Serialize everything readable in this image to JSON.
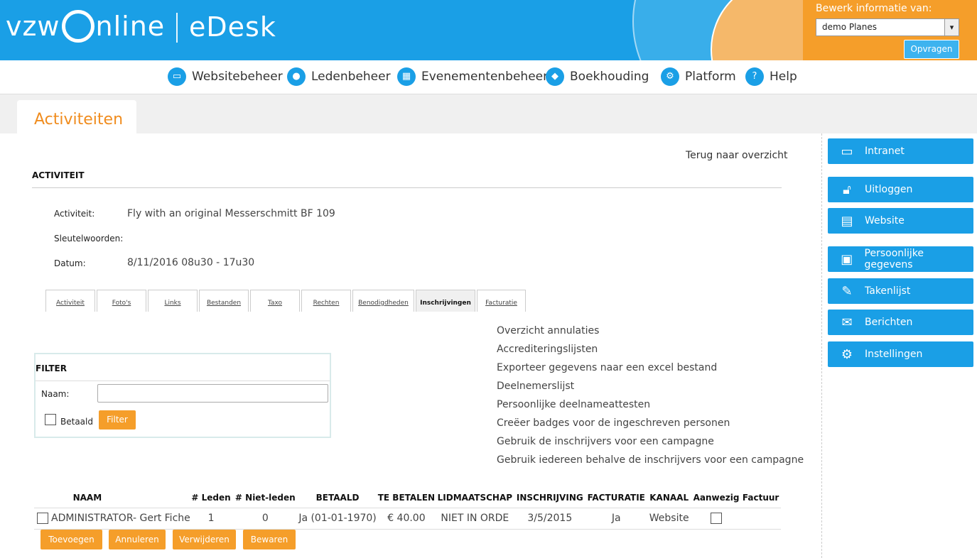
{
  "header": {
    "logo_left": "vzw",
    "logo_right": "nline",
    "product": "eDesk",
    "bewerk_label": "Bewerk informatie van:",
    "bewerk_value": "demo Planes",
    "opvragen": "Opvragen"
  },
  "nav": [
    {
      "label": "Websitebeheer",
      "icon": "monitor-icon"
    },
    {
      "label": "Ledenbeheer",
      "icon": "user-icon"
    },
    {
      "label": "Evenementenbeheer",
      "icon": "calendar-icon"
    },
    {
      "label": "Boekhouding",
      "icon": "coins-icon"
    },
    {
      "label": "Platform",
      "icon": "gears-icon"
    },
    {
      "label": "Help",
      "icon": "help-icon"
    }
  ],
  "page_title": "Activiteiten",
  "sidebar": [
    {
      "label": "Intranet",
      "icon": "monitor-lock-icon"
    },
    {
      "label": "Uitloggen",
      "icon": "unlock-icon"
    },
    {
      "label": "Website",
      "icon": "website-icon"
    },
    {
      "label": "Persoonlijke gegevens",
      "icon": "id-card-icon"
    },
    {
      "label": "Takenlijst",
      "icon": "pencil-icon"
    },
    {
      "label": "Berichten",
      "icon": "envelope-icon"
    },
    {
      "label": "Instellingen",
      "icon": "gear-icon"
    }
  ],
  "main": {
    "terug": "Terug naar overzicht",
    "section_title": "ACTIVITEIT",
    "fields": {
      "activiteit_label": "Activiteit:",
      "activiteit_value": "Fly with an original Messerschmitt BF 109",
      "sleutel_label": "Sleutelwoorden:",
      "datum_label": "Datum:",
      "datum_value": "8/11/2016 08u30 - 17u30"
    },
    "tabs": [
      "Activiteit",
      "Foto's",
      "Links",
      "Bestanden",
      "Taxo",
      "Rechten",
      "Benodigdheden",
      "Inschrijvingen",
      "Facturatie"
    ],
    "active_tab": "Inschrijvingen",
    "links": [
      "Overzicht annulaties",
      "Accrediteringslijsten",
      "Exporteer gegevens naar een excel bestand",
      "Deelnemerslijst",
      "Persoonlijke deelnameattesten",
      "Creëer badges voor de ingeschreven personen",
      "Gebruik de inschrijvers voor een campagne",
      "Gebruik iedereen behalve de inschrijvers voor een campagne"
    ],
    "filter": {
      "title": "FILTER",
      "naam_label": "Naam:",
      "naam_value": "",
      "betaald_label": "Betaald",
      "button": "Filter"
    },
    "table": {
      "columns": [
        "NAAM",
        "# Leden",
        "# Niet-leden",
        "BETAALD",
        "TE BETALEN",
        "LIDMAATSCHAP",
        "INSCHRIJVING",
        "FACTURATIE",
        "KANAAL",
        "Aanwezig",
        "Factuur"
      ],
      "rows": [
        {
          "naam": "ADMINISTRATOR- Gert Fiche",
          "leden": "1",
          "niet_leden": "0",
          "betaald": "Ja (01-01-1970)",
          "te_betalen": "€ 40.00",
          "lidmaatschap": "NIET IN ORDE",
          "inschrijving": "3/5/2015",
          "facturatie": "Ja",
          "kanaal": "Website",
          "factuur": ""
        }
      ]
    },
    "actions": [
      "Toevoegen",
      "Annuleren",
      "Verwijderen",
      "Bewaren"
    ]
  }
}
